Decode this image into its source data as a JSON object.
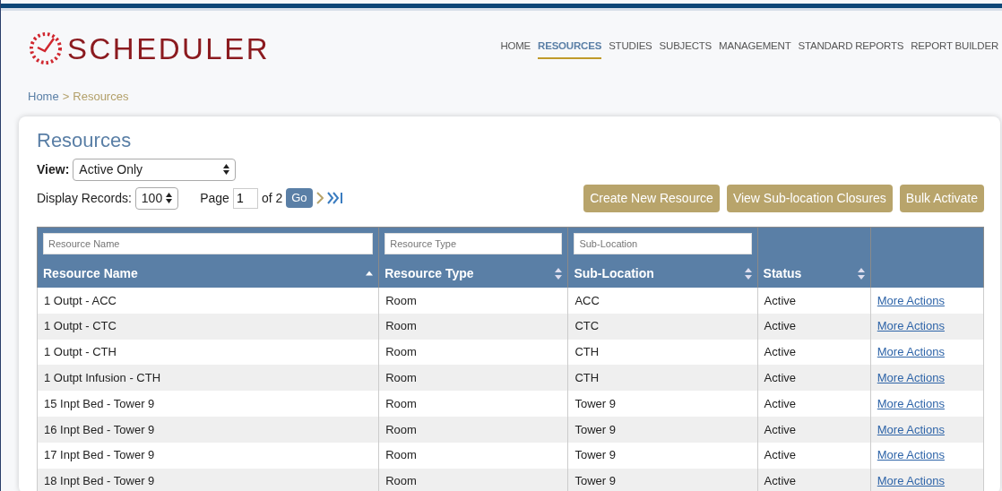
{
  "app": {
    "title": "SCHEDULER"
  },
  "nav": [
    {
      "label": "HOME",
      "selected": false
    },
    {
      "label": "RESOURCES",
      "selected": true
    },
    {
      "label": "STUDIES",
      "selected": false
    },
    {
      "label": "SUBJECTS",
      "selected": false
    },
    {
      "label": "MANAGEMENT",
      "selected": false
    },
    {
      "label": "STANDARD REPORTS",
      "selected": false
    },
    {
      "label": "REPORT BUILDER",
      "selected": false
    }
  ],
  "breadcrumb": [
    {
      "label": "Home",
      "kind": "link"
    },
    {
      "label": ">",
      "kind": "separator"
    },
    {
      "label": "Resources",
      "kind": "current"
    }
  ],
  "page_title": "Resources",
  "view": {
    "label": "View:",
    "value": "Active Only"
  },
  "pager": {
    "records_label": "Display Records:",
    "records_value": "100",
    "page_label": "Page",
    "page_value": "1",
    "of_label": "of 2",
    "go": "Go"
  },
  "actions": [
    "Create New Resource",
    "View Sub-location Closures",
    "Bulk Activate"
  ],
  "table": {
    "columns": [
      {
        "label": "Resource Name",
        "placeholder": "Resource Name",
        "sortable": true,
        "sorted": true
      },
      {
        "label": "Resource Type",
        "placeholder": "Resource Type",
        "sortable": true,
        "sorted": false
      },
      {
        "label": "Sub-Location",
        "placeholder": "Sub-Location",
        "sortable": true,
        "sorted": false
      },
      {
        "label": "Status",
        "sortable": true,
        "sorted": false
      },
      {
        "sortable": false
      }
    ],
    "rows": [
      [
        "1 Outpt - ACC",
        "Room",
        "ACC",
        "Active",
        "More Actions"
      ],
      [
        "1 Outpt - CTC",
        "Room",
        "CTC",
        "Active",
        "More Actions"
      ],
      [
        "1 Outpt - CTH",
        "Room",
        "CTH",
        "Active",
        "More Actions"
      ],
      [
        "1 Outpt Infusion - CTH",
        "Room",
        "CTH",
        "Active",
        "More Actions"
      ],
      [
        "15 Inpt Bed - Tower 9",
        "Room",
        "Tower 9",
        "Active",
        "More Actions"
      ],
      [
        "16 Inpt Bed - Tower 9",
        "Room",
        "Tower 9",
        "Active",
        "More Actions"
      ],
      [
        "17 Inpt Bed - Tower 9",
        "Room",
        "Tower 9",
        "Active",
        "More Actions"
      ],
      [
        "18 Inpt Bed - Tower 9",
        "Room",
        "Tower 9",
        "Active",
        "More Actions"
      ]
    ]
  }
}
